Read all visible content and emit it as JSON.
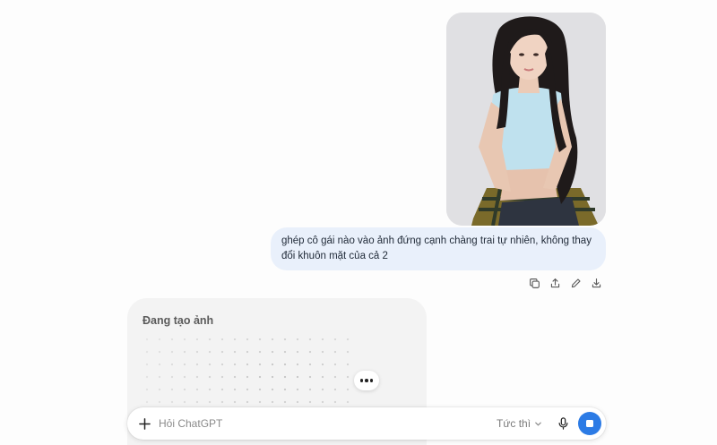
{
  "conversation": {
    "user_message": {
      "text": "ghép cô gái nào vào ảnh đứng cạnh chàng trai tự nhiên, không thay đổi khuôn mặt của cả 2",
      "attachment_icon": "photo-of-woman"
    },
    "message_actions": [
      "copy-icon",
      "share-icon",
      "edit-icon",
      "download-icon"
    ],
    "assistant": {
      "status_text": "Đang tạo ảnh",
      "more_icon": "ellipsis-icon"
    }
  },
  "composer": {
    "placeholder": "Hỏi ChatGPT",
    "value": "",
    "model_label": "Tức thì",
    "icons": [
      "plus-icon",
      "chevron-down-icon",
      "microphone-icon",
      "stop-icon"
    ]
  },
  "colors": {
    "user_bubble": "#e9f0fb",
    "card_bg": "#f3f3f3",
    "accent": "#2c7be5"
  }
}
